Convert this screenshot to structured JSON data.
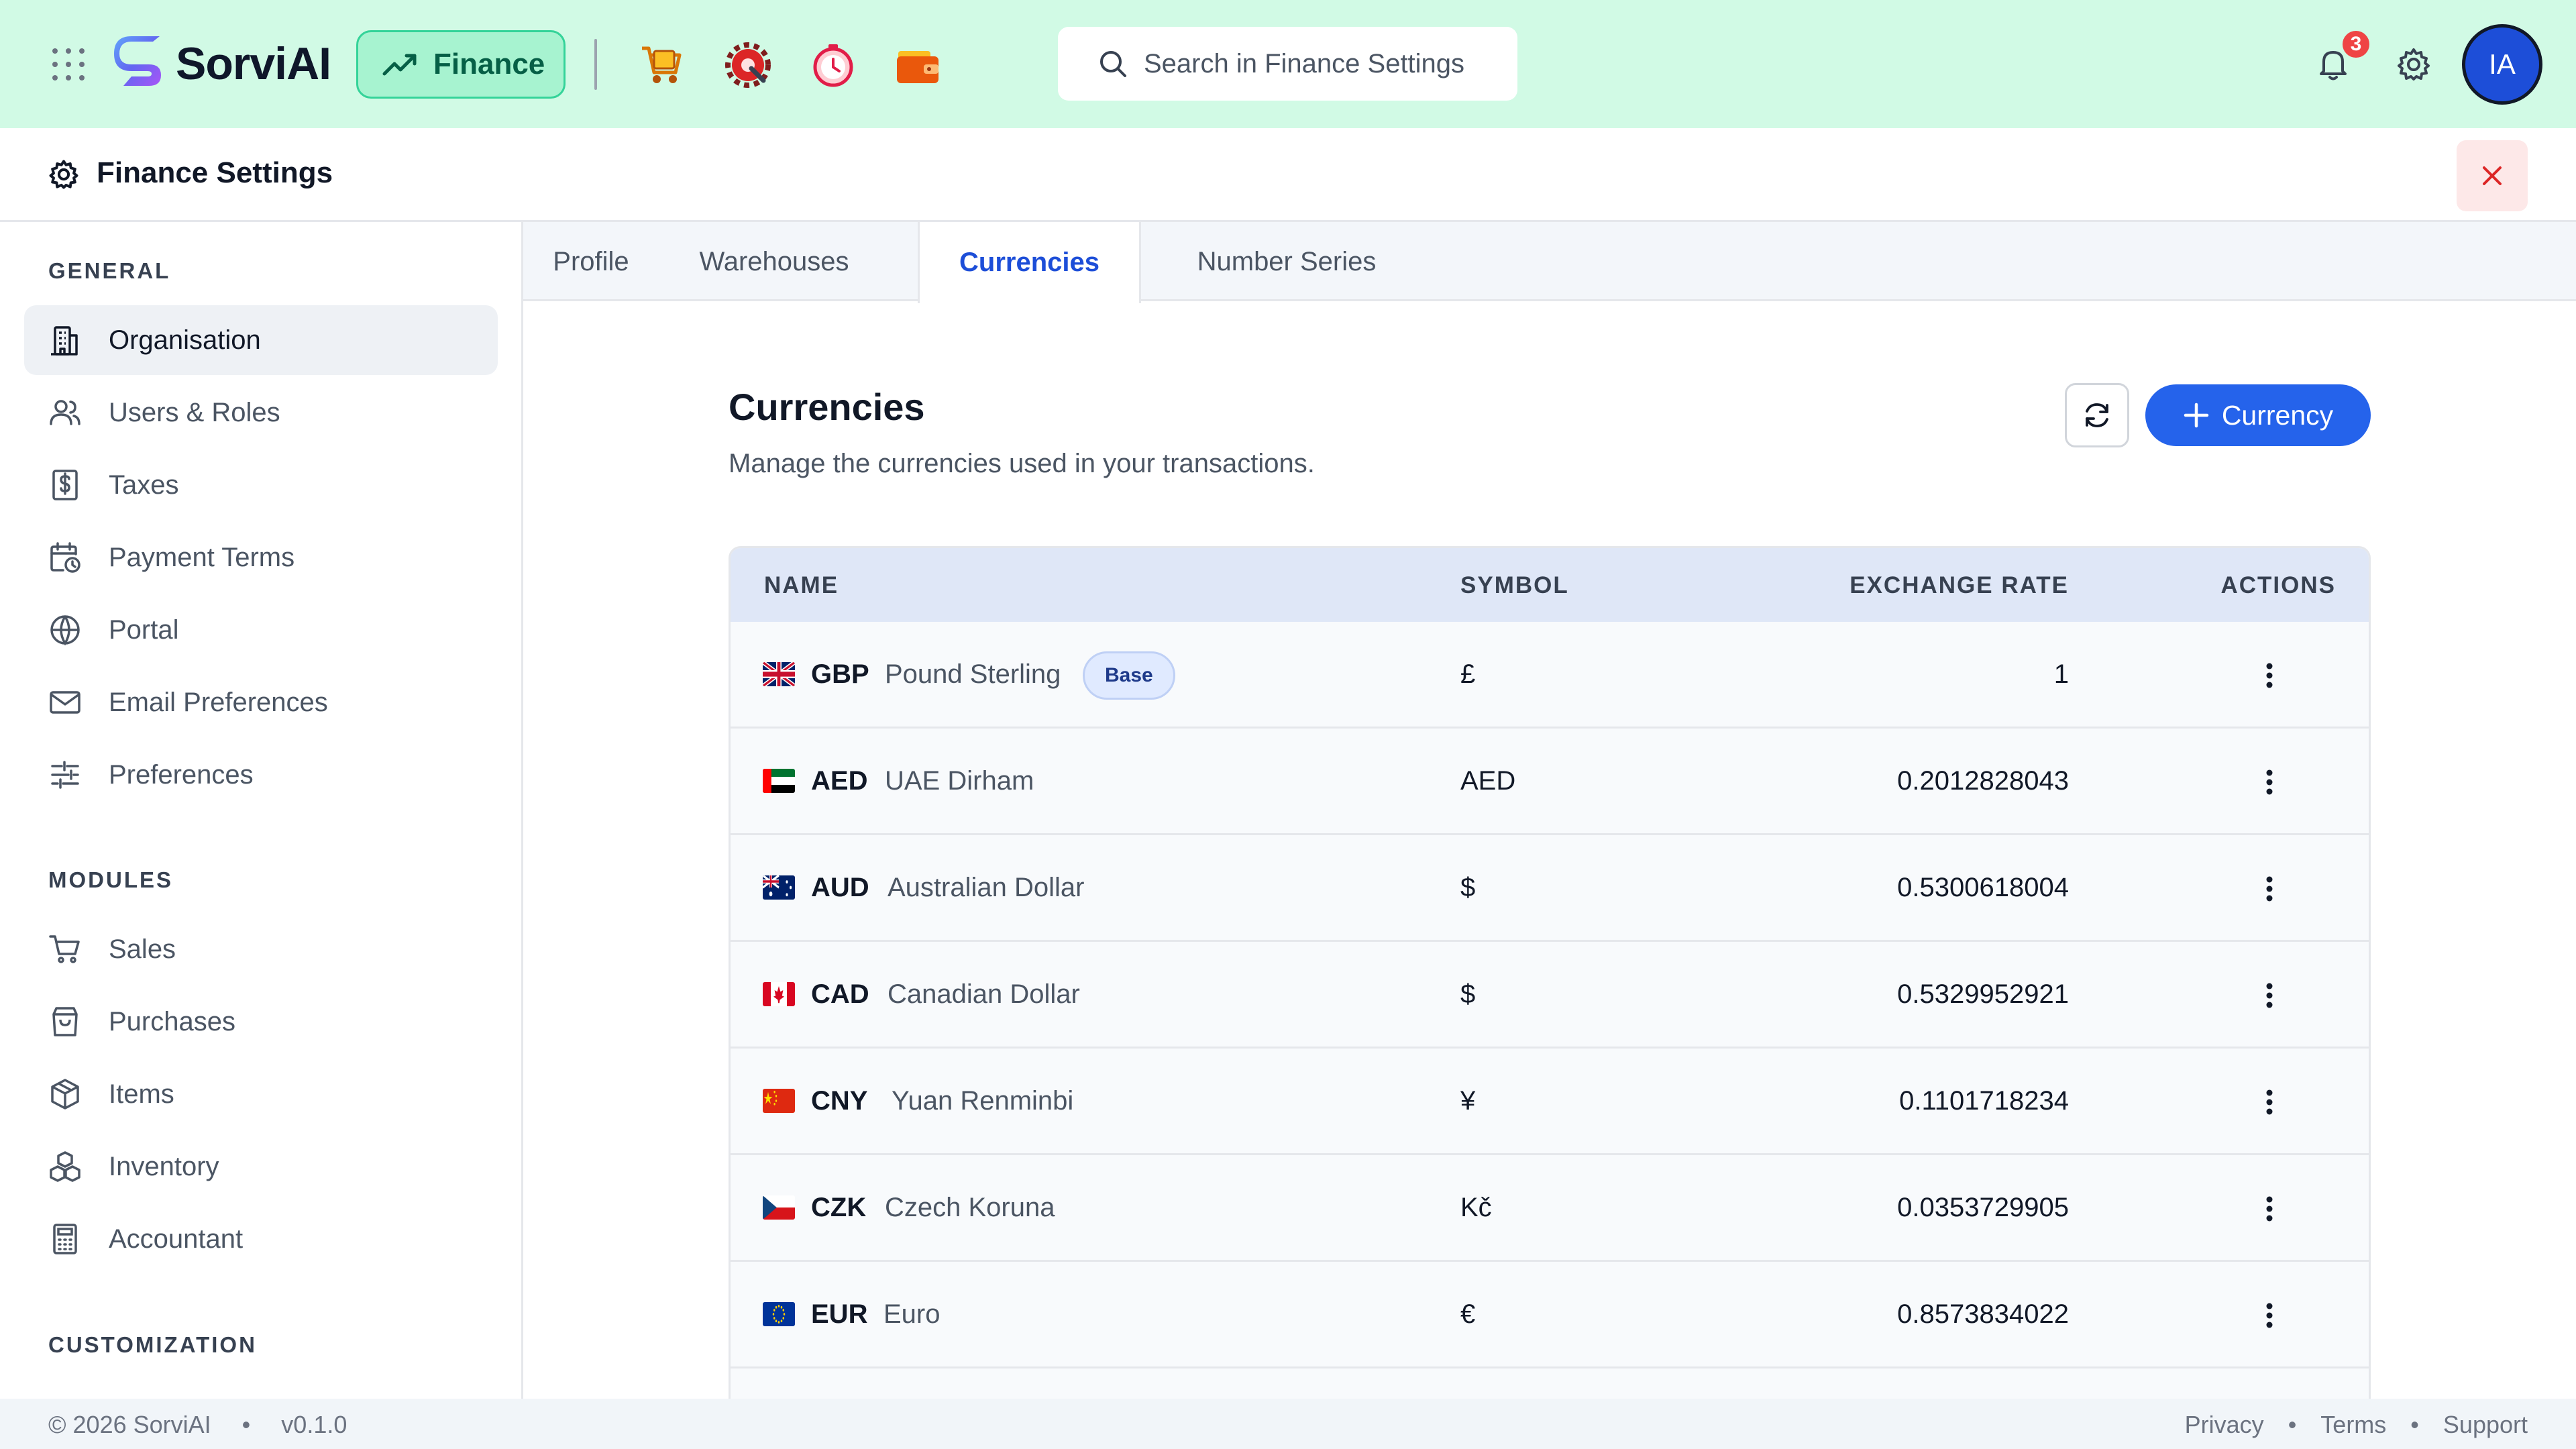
{
  "topbar": {
    "brand": "SorviAI",
    "module_label": "Finance",
    "search_placeholder": "Search in Finance Settings",
    "notification_count": "3",
    "avatar_initials": "IA",
    "apps": [
      "shopping-cart-app-icon",
      "tools-app-icon",
      "clock-app-icon",
      "wallet-app-icon"
    ]
  },
  "page": {
    "title": "Finance Settings"
  },
  "sidebar": {
    "sections": [
      {
        "label": "GENERAL",
        "items": [
          {
            "label": "Organisation",
            "icon": "building-icon",
            "active": true
          },
          {
            "label": "Users & Roles",
            "icon": "users-icon"
          },
          {
            "label": "Taxes",
            "icon": "dollar-receipt-icon"
          },
          {
            "label": "Payment Terms",
            "icon": "calendar-clock-icon"
          },
          {
            "label": "Portal",
            "icon": "globe-icon"
          },
          {
            "label": "Email Preferences",
            "icon": "mail-icon"
          },
          {
            "label": "Preferences",
            "icon": "sliders-icon"
          }
        ]
      },
      {
        "label": "MODULES",
        "items": [
          {
            "label": "Sales",
            "icon": "cart-icon"
          },
          {
            "label": "Purchases",
            "icon": "shopping-bag-icon"
          },
          {
            "label": "Items",
            "icon": "box-icon"
          },
          {
            "label": "Inventory",
            "icon": "boxes-icon"
          },
          {
            "label": "Accountant",
            "icon": "calculator-icon"
          }
        ]
      },
      {
        "label": "CUSTOMIZATION",
        "items": []
      }
    ]
  },
  "tabs": [
    {
      "label": "Profile"
    },
    {
      "label": "Warehouses"
    },
    {
      "label": "Currencies",
      "active": true
    },
    {
      "label": "Number Series"
    }
  ],
  "currencies": {
    "title": "Currencies",
    "subtitle": "Manage the currencies used in your transactions.",
    "add_label": "Currency",
    "columns": [
      "NAME",
      "SYMBOL",
      "EXCHANGE RATE",
      "ACTIONS"
    ],
    "base_label": "Base",
    "rows": [
      {
        "flag": "gb",
        "code": "GBP",
        "name": "Pound Sterling",
        "symbol": "£",
        "rate": "1",
        "base": true
      },
      {
        "flag": "ae",
        "code": "AED",
        "name": "UAE Dirham",
        "symbol": "AED",
        "rate": "0.2012828043"
      },
      {
        "flag": "au",
        "code": "AUD",
        "name": "Australian Dollar",
        "symbol": "$",
        "rate": "0.5300618004"
      },
      {
        "flag": "ca",
        "code": "CAD",
        "name": "Canadian Dollar",
        "symbol": "$",
        "rate": "0.5329952921"
      },
      {
        "flag": "cn",
        "code": "CNY",
        "name": "Yuan Renminbi",
        "symbol": "¥",
        "rate": "0.1101718234"
      },
      {
        "flag": "cz",
        "code": "CZK",
        "name": "Czech Koruna",
        "symbol": "Kč",
        "rate": "0.0353729905"
      },
      {
        "flag": "eu",
        "code": "EUR",
        "name": "Euro",
        "symbol": "€",
        "rate": "0.8573834022"
      }
    ]
  },
  "footer": {
    "copyright": "© 2026 SorviAI",
    "version": "v0.1.0",
    "links": [
      "Privacy",
      "Terms",
      "Support"
    ]
  },
  "colors": {
    "topbar_bg": "#d1fae5",
    "accent": "#2563eb",
    "active_tab": "#1d4ed8",
    "badge": "#ef4444"
  }
}
